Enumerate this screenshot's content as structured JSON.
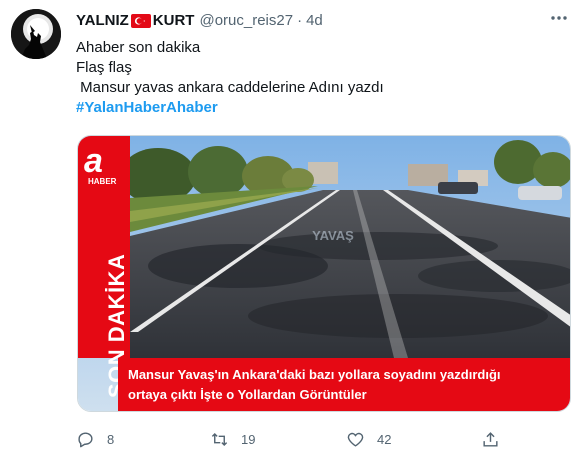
{
  "tweet": {
    "display_name_part1": "YALNIZ",
    "display_name_part2": "KURT",
    "handle": "@oruc_reis27",
    "separator": "·",
    "time": "4d",
    "lines": [
      "Ahaber son dakika",
      "Flaş flaş",
      " Mansur yavas ankara caddelerine Adını yazdı"
    ],
    "hashtag": "#YalanHaberAhaber"
  },
  "media": {
    "channel_logo": "a",
    "channel_sub": "HABER",
    "banner_text": "SON DAKİKA",
    "caption_line1": "Mansur Yavaş'ın Ankara'daki bazı yollara soyadını yazdırdığı",
    "caption_line2": "ortaya çıktı İşte o Yollardan Görüntüler",
    "road_text": "YAVAŞ"
  },
  "actions": {
    "reply_count": "8",
    "retweet_count": "19",
    "like_count": "42"
  },
  "icons": {
    "avatar": "wolf-icon",
    "flag": "turkey-flag-icon",
    "more": "more-dots-icon",
    "reply": "reply-icon",
    "retweet": "retweet-icon",
    "like": "heart-icon",
    "share": "share-icon"
  },
  "colors": {
    "accent": "#1d9bf0",
    "secondary_text": "#536471",
    "brand_red": "#e50914"
  }
}
